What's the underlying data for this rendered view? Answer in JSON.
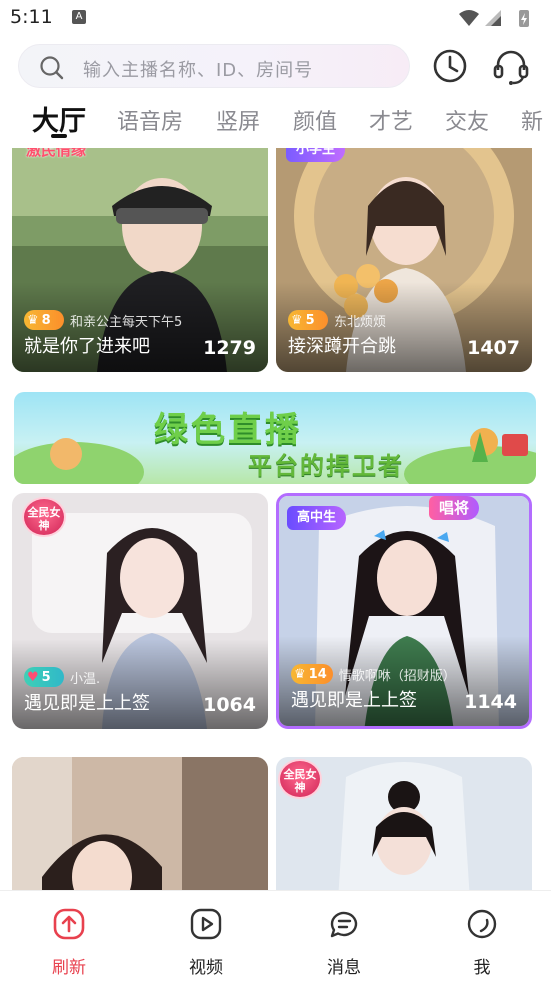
{
  "status_bar": {
    "time": "5:11",
    "notification_glyph": "A"
  },
  "search": {
    "placeholder": "输入主播名称、ID、房间号"
  },
  "tabs": [
    {
      "label": "大厅",
      "active": true
    },
    {
      "label": "语音房"
    },
    {
      "label": "竖屏"
    },
    {
      "label": "颜值"
    },
    {
      "label": "才艺"
    },
    {
      "label": "交友"
    },
    {
      "label": "新"
    }
  ],
  "cards": [
    {
      "title": "就是你了进来吧",
      "viewers": "1279",
      "level": "8",
      "host": "和亲公主每天下午5",
      "tag": "激民情缘"
    },
    {
      "title": "接深蹲开合跳",
      "viewers": "1407",
      "level": "5",
      "host": "东北烦烦",
      "tag": "小学生"
    },
    {
      "title": "遇见即是上上签",
      "viewers": "1064",
      "level": "5",
      "host": "小温.",
      "tag": "全民女神"
    },
    {
      "title": "遇见即是上上签",
      "viewers": "1144",
      "level": "14",
      "host": "情歌啊咻（招财版）",
      "tag": "高中生",
      "tag2": "唱将"
    },
    {
      "tag": ""
    },
    {
      "tag": "全民女神"
    }
  ],
  "banner": {
    "title": "绿色直播",
    "subtitle": "平台的捍卫者"
  },
  "bottom_nav": [
    {
      "label": "刷新",
      "active": true,
      "icon": "refresh-up-icon"
    },
    {
      "label": "视频",
      "icon": "video-play-icon"
    },
    {
      "label": "消息",
      "icon": "message-icon"
    },
    {
      "label": "我",
      "icon": "profile-icon"
    }
  ],
  "colors": {
    "accent": "#e8414e",
    "level_gold": "#f7b733",
    "banner_green": "#6fcf4a"
  }
}
